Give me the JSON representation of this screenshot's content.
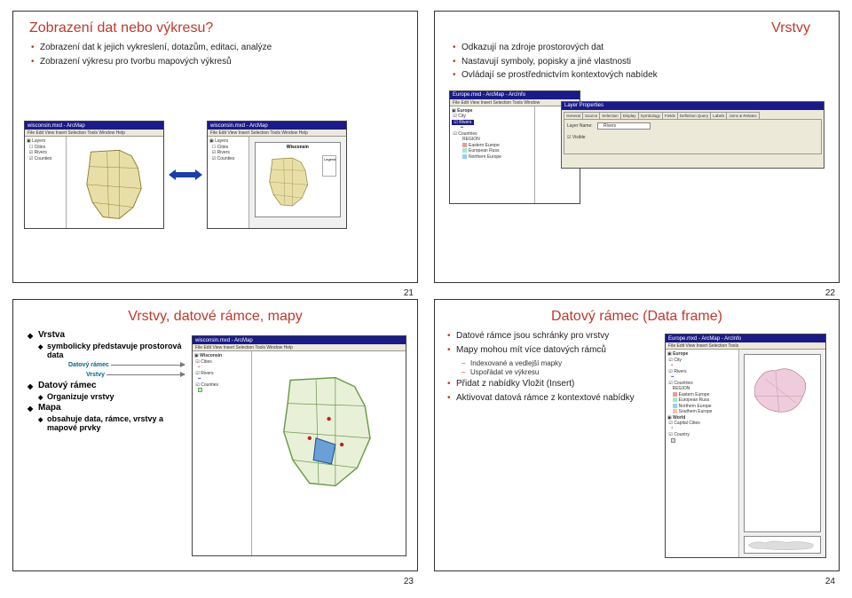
{
  "slide21": {
    "title": "Zobrazení dat nebo výkresu?",
    "bullets": [
      "Zobrazení dat k jejich vykreslení, dotazům, editaci, analýze",
      "Zobrazení výkresu pro tvorbu mapových výkresů"
    ],
    "winA": {
      "title": "wisconsin.mxd - ArcMap",
      "menu": "File Edit View Insert Selection Tools Window Help"
    },
    "winB": {
      "title": "wisconsin.mxd - ArcMap",
      "menu": "File Edit View Insert Selection Tools Window Help"
    },
    "mapLabel": "Wisconsin",
    "pagenum": "21"
  },
  "slide22": {
    "title": "Vrstvy",
    "bullets": [
      "Odkazují na zdroje prostorových dat",
      "Nastavují symboly, popisky a jiné vlastnosti",
      "Ovládají se prostřednictvím kontextových nabídek"
    ],
    "win": {
      "title": "Europe.mxd - ArcMap - ArcInfo",
      "menu": "File Edit View Insert Selection Tools Window"
    },
    "propsTitle": "Layer Properties",
    "tabs": [
      "General",
      "Source",
      "Selection",
      "Display",
      "Symbology",
      "Fields",
      "Definition Query",
      "Labels",
      "Joins & Relates"
    ],
    "propsLabel1": "Layer Name:",
    "propsValue1": "Rivers",
    "propsVisible": "Visible",
    "toc": {
      "europe": "Europe",
      "city": "City",
      "rivers": "Rivers",
      "countries": "Countries",
      "region": "REGION",
      "r1": "Eastern Europe",
      "r2": "European Russ",
      "r3": "Northern Europe"
    },
    "pagenum": "22"
  },
  "slide23": {
    "title": "Vrstvy, datové rámce, mapy",
    "head1": "Vrstva",
    "sub1": "symbolicky představuje prostorová data",
    "label_frame": "Datový rámec",
    "label_layers": "Vrstvy",
    "head2": "Datový rámec",
    "sub2": "Organizuje vrstvy",
    "head3": "Mapa",
    "sub3": "obsahuje data, rámce, vrstvy a mapové prvky",
    "win": {
      "title": "wisconsin.mxd - ArcMap",
      "menu": "File Edit View Insert Selection Tools Window Help"
    },
    "toc": {
      "frame": "Wisconsin",
      "l1": "Cities",
      "l2": "Rivers",
      "l3": "Counties"
    },
    "pagenum": "23"
  },
  "slide24": {
    "title": "Datový rámec (Data frame)",
    "bullets": [
      "Datové rámce jsou schránky pro vrstvy",
      "Mapy mohou mít více datových rámců"
    ],
    "sub_dash": [
      "Indexované a vedlejší mapky",
      "Uspořádat ve výkresu"
    ],
    "bullets2": [
      "Přidat z nabídky Vložit (Insert)",
      "Aktivovat datová rámce z kontextové nabídky"
    ],
    "win": {
      "title": "Europe.mxd - ArcMap - ArcInfo",
      "menu": "File Edit View Insert Selection Tools"
    },
    "toc": {
      "europe": "Europe",
      "city": "City",
      "rivers": "Rivers",
      "countries": "Countries",
      "region": "REGION",
      "r1": "Eastern Europe",
      "r2": "European Russ",
      "r3": "Northern Europe",
      "r4": "Southern Europe",
      "world": "World",
      "cap": "Capital Cities",
      "ctry": "Country"
    },
    "pagenum": "24"
  }
}
